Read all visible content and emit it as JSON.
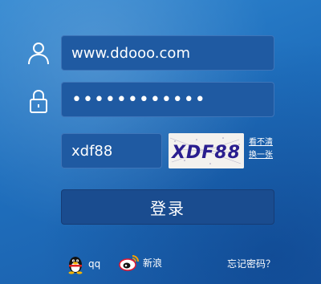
{
  "form": {
    "username": "www.ddooo.com",
    "password_masked": "••••••••••••",
    "captcha_value": "xdf88",
    "captcha_image_text": "XDF88",
    "cant_see_link": "看不清",
    "change_link": "换一张",
    "login_button": "登录"
  },
  "social": {
    "qq_label": "qq",
    "weibo_label": "新浪"
  },
  "forgot_password": "忘记密码？",
  "icons": {
    "user": "user-icon",
    "lock": "lock-icon",
    "qq": "qq-penguin-icon",
    "weibo": "weibo-icon"
  },
  "colors": {
    "background": "#1f6fbd",
    "field_bg": "#1f5aa2",
    "button_bg": "#1a4c8f",
    "captcha_text": "#2a1e8f"
  }
}
